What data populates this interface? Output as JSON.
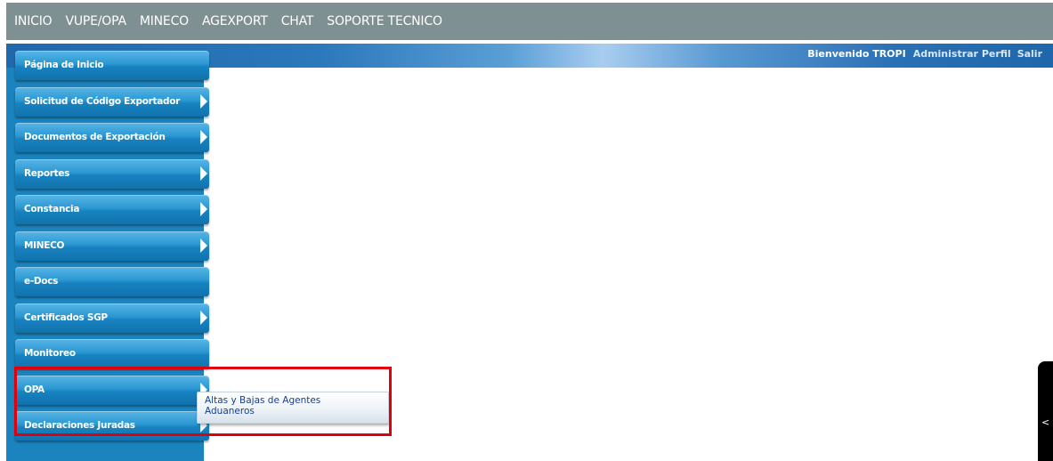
{
  "topnav": {
    "items": [
      "INICIO",
      "VUPE/OPA",
      "MINECO",
      "AGEXPORT",
      "CHAT",
      "SOPORTE TECNICO"
    ]
  },
  "welcome": {
    "text": "Bienvenido TROPI",
    "profile_link": "Administrar Perfil",
    "logout_link": "Salir"
  },
  "sidebar": {
    "items": [
      {
        "label": "Página de Inicio",
        "has_submenu": false
      },
      {
        "label": "Solicitud de Código Exportador",
        "has_submenu": true
      },
      {
        "label": "Documentos de Exportación",
        "has_submenu": true
      },
      {
        "label": "Reportes",
        "has_submenu": true
      },
      {
        "label": "Constancia",
        "has_submenu": true
      },
      {
        "label": "MINECO",
        "has_submenu": true
      },
      {
        "label": "e-Docs",
        "has_submenu": false
      },
      {
        "label": "Certificados SGP",
        "has_submenu": true
      },
      {
        "label": "Monitoreo",
        "has_submenu": false
      },
      {
        "label": "OPA",
        "has_submenu": true
      },
      {
        "label": "Declaraciones Juradas",
        "has_submenu": true
      }
    ]
  },
  "submenu": {
    "parent": "OPA",
    "items": [
      "Altas y Bajas de Agentes Aduaneros"
    ]
  },
  "collapse_handle": {
    "glyph": "<"
  },
  "colors": {
    "topnav_bg": "#7f9093",
    "sidebar_bg": "#1b83bd",
    "highlight": "#e0000c",
    "submenu_text": "#163f8f"
  }
}
